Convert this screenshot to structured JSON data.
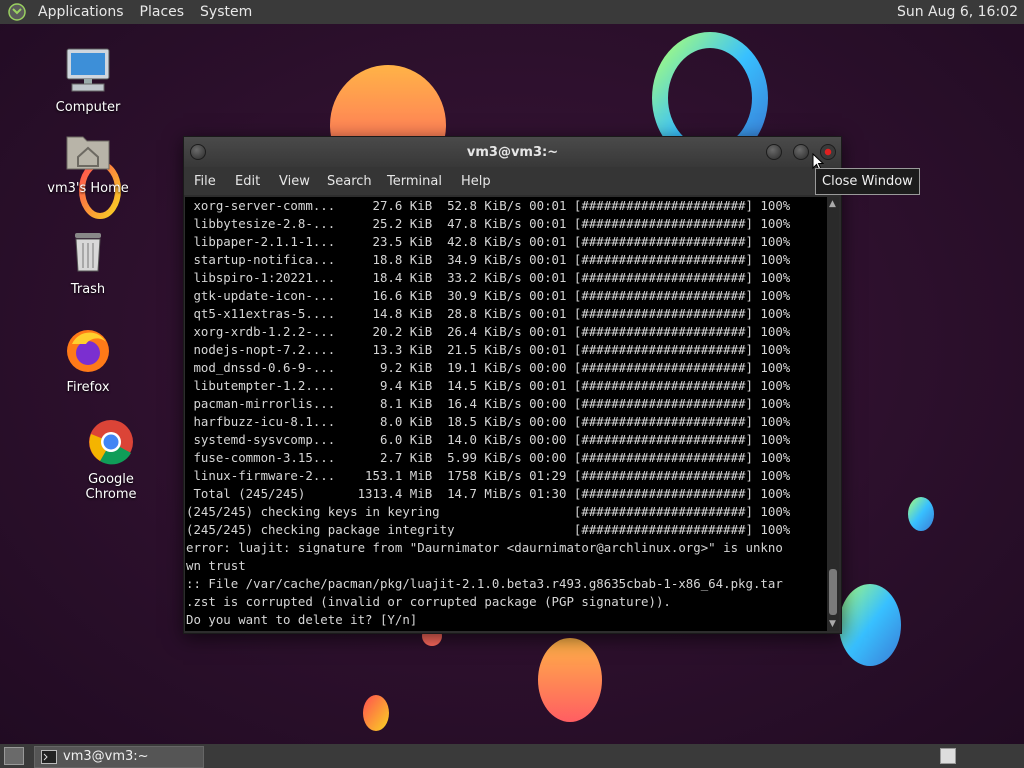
{
  "top_panel": {
    "applications": "Applications",
    "places": "Places",
    "system": "System",
    "clock": "Sun Aug  6, 16:02"
  },
  "desktop": {
    "icons": [
      {
        "label": "Computer"
      },
      {
        "label": "vm3's Home"
      },
      {
        "label": "Trash"
      },
      {
        "label": "Firefox"
      },
      {
        "label": "Google Chrome"
      }
    ]
  },
  "window": {
    "title": "vm3@vm3:~",
    "menu": [
      "File",
      "Edit",
      "View",
      "Search",
      "Terminal",
      "Help"
    ],
    "tooltip": "Close Window"
  },
  "terminal": {
    "lines": [
      " xorg-server-comm...     27.6 KiB  52.8 KiB/s 00:01 [######################] 100%",
      " libbytesize-2.8-...     25.2 KiB  47.8 KiB/s 00:01 [######################] 100%",
      " libpaper-2.1.1-1...     23.5 KiB  42.8 KiB/s 00:01 [######################] 100%",
      " startup-notifica...     18.8 KiB  34.9 KiB/s 00:01 [######################] 100%",
      " libspiro-1:20221...     18.4 KiB  33.2 KiB/s 00:01 [######################] 100%",
      " gtk-update-icon-...     16.6 KiB  30.9 KiB/s 00:01 [######################] 100%",
      " qt5-x11extras-5....     14.8 KiB  28.8 KiB/s 00:01 [######################] 100%",
      " xorg-xrdb-1.2.2-...     20.2 KiB  26.4 KiB/s 00:01 [######################] 100%",
      " nodejs-nopt-7.2....     13.3 KiB  21.5 KiB/s 00:01 [######################] 100%",
      " mod_dnssd-0.6-9-...      9.2 KiB  19.1 KiB/s 00:00 [######################] 100%",
      " libutempter-1.2....      9.4 KiB  14.5 KiB/s 00:01 [######################] 100%",
      " pacman-mirrorlis...      8.1 KiB  16.4 KiB/s 00:00 [######################] 100%",
      " harfbuzz-icu-8.1...      8.0 KiB  18.5 KiB/s 00:00 [######################] 100%",
      " systemd-sysvcomp...      6.0 KiB  14.0 KiB/s 00:00 [######################] 100%",
      " fuse-common-3.15...      2.7 KiB  5.99 KiB/s 00:00 [######################] 100%",
      " linux-firmware-2...    153.1 MiB  1758 KiB/s 01:29 [######################] 100%",
      " Total (245/245)       1313.4 MiB  14.7 MiB/s 01:30 [######################] 100%",
      "(245/245) checking keys in keyring                  [######################] 100%",
      "(245/245) checking package integrity                [######################] 100%",
      "error: luajit: signature from \"Daurnimator <daurnimator@archlinux.org>\" is unkno",
      "wn trust",
      ":: File /var/cache/pacman/pkg/luajit-2.1.0.beta3.r493.g8635cbab-1-x86_64.pkg.tar",
      ".zst is corrupted (invalid or corrupted package (PGP signature)).",
      "Do you want to delete it? [Y/n]"
    ]
  },
  "taskbar": {
    "item": "vm3@vm3:~"
  },
  "colors": {
    "wallpaper": "#2a0f2b",
    "panel": "#3a3a3a",
    "terminal_bg": "#000000",
    "terminal_fg": "#d6d6d6"
  }
}
